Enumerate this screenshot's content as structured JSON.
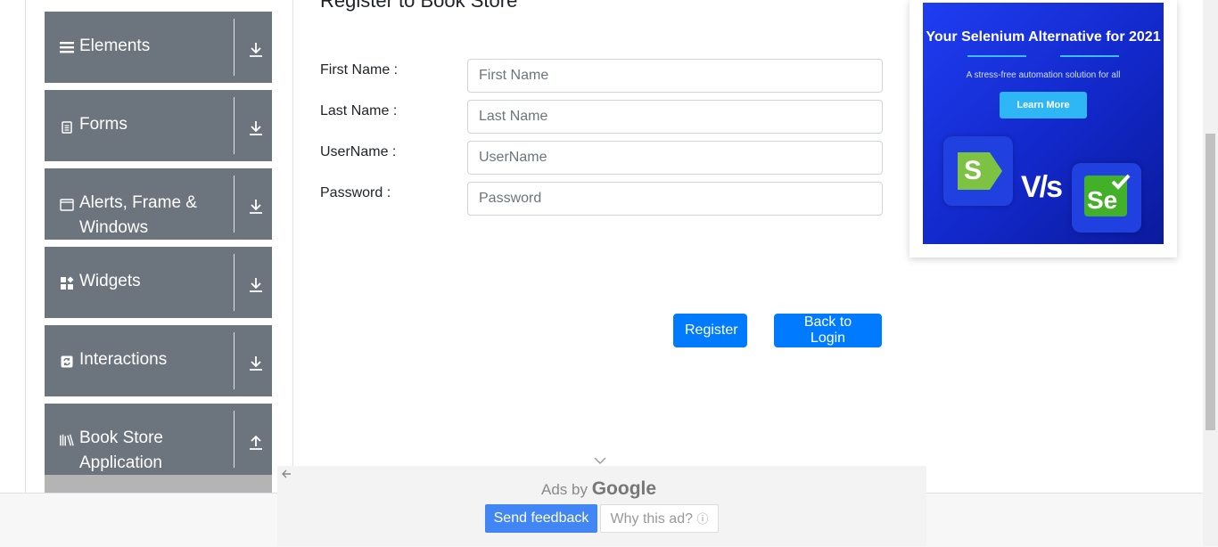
{
  "sidebar": {
    "groups": [
      {
        "label": "Elements",
        "icon": "hamburger-icon",
        "arrow": "download-arrow-icon"
      },
      {
        "label": "Forms",
        "icon": "document-icon",
        "arrow": "download-arrow-icon"
      },
      {
        "label": "Alerts, Frame & Windows",
        "icon": "window-icon",
        "arrow": "download-arrow-icon"
      },
      {
        "label": "Widgets",
        "icon": "widgets-icon",
        "arrow": "download-arrow-icon"
      },
      {
        "label": "Interactions",
        "icon": "refresh-icon",
        "arrow": "download-arrow-icon"
      },
      {
        "label": "Book Store Application",
        "icon": "books-icon",
        "arrow": "upload-arrow-icon"
      }
    ]
  },
  "form": {
    "title": "Register to Book Store",
    "fields": [
      {
        "label": "First Name :",
        "placeholder": "First Name",
        "value": ""
      },
      {
        "label": "Last Name :",
        "placeholder": "Last Name",
        "value": ""
      },
      {
        "label": "UserName :",
        "placeholder": "UserName",
        "value": ""
      },
      {
        "label": "Password :",
        "placeholder": "Password",
        "value": ""
      }
    ],
    "register_label": "Register",
    "back_label": "Back to Login"
  },
  "side_ad": {
    "title": "Your Selenium Alternative for 2021",
    "subtitle": "A stress-free automation solution for all",
    "cta": "Learn More",
    "vs": "V/s",
    "left_logo": "S",
    "right_logo": "Se"
  },
  "bottom_ad": {
    "ads_by": "Ads by",
    "brand": "Google",
    "send_feedback": "Send feedback",
    "why_this_ad": "Why this ad?"
  },
  "colors": {
    "sidebar_bg": "#6c757d",
    "primary": "#007bff",
    "google_blue": "#4285f4"
  }
}
